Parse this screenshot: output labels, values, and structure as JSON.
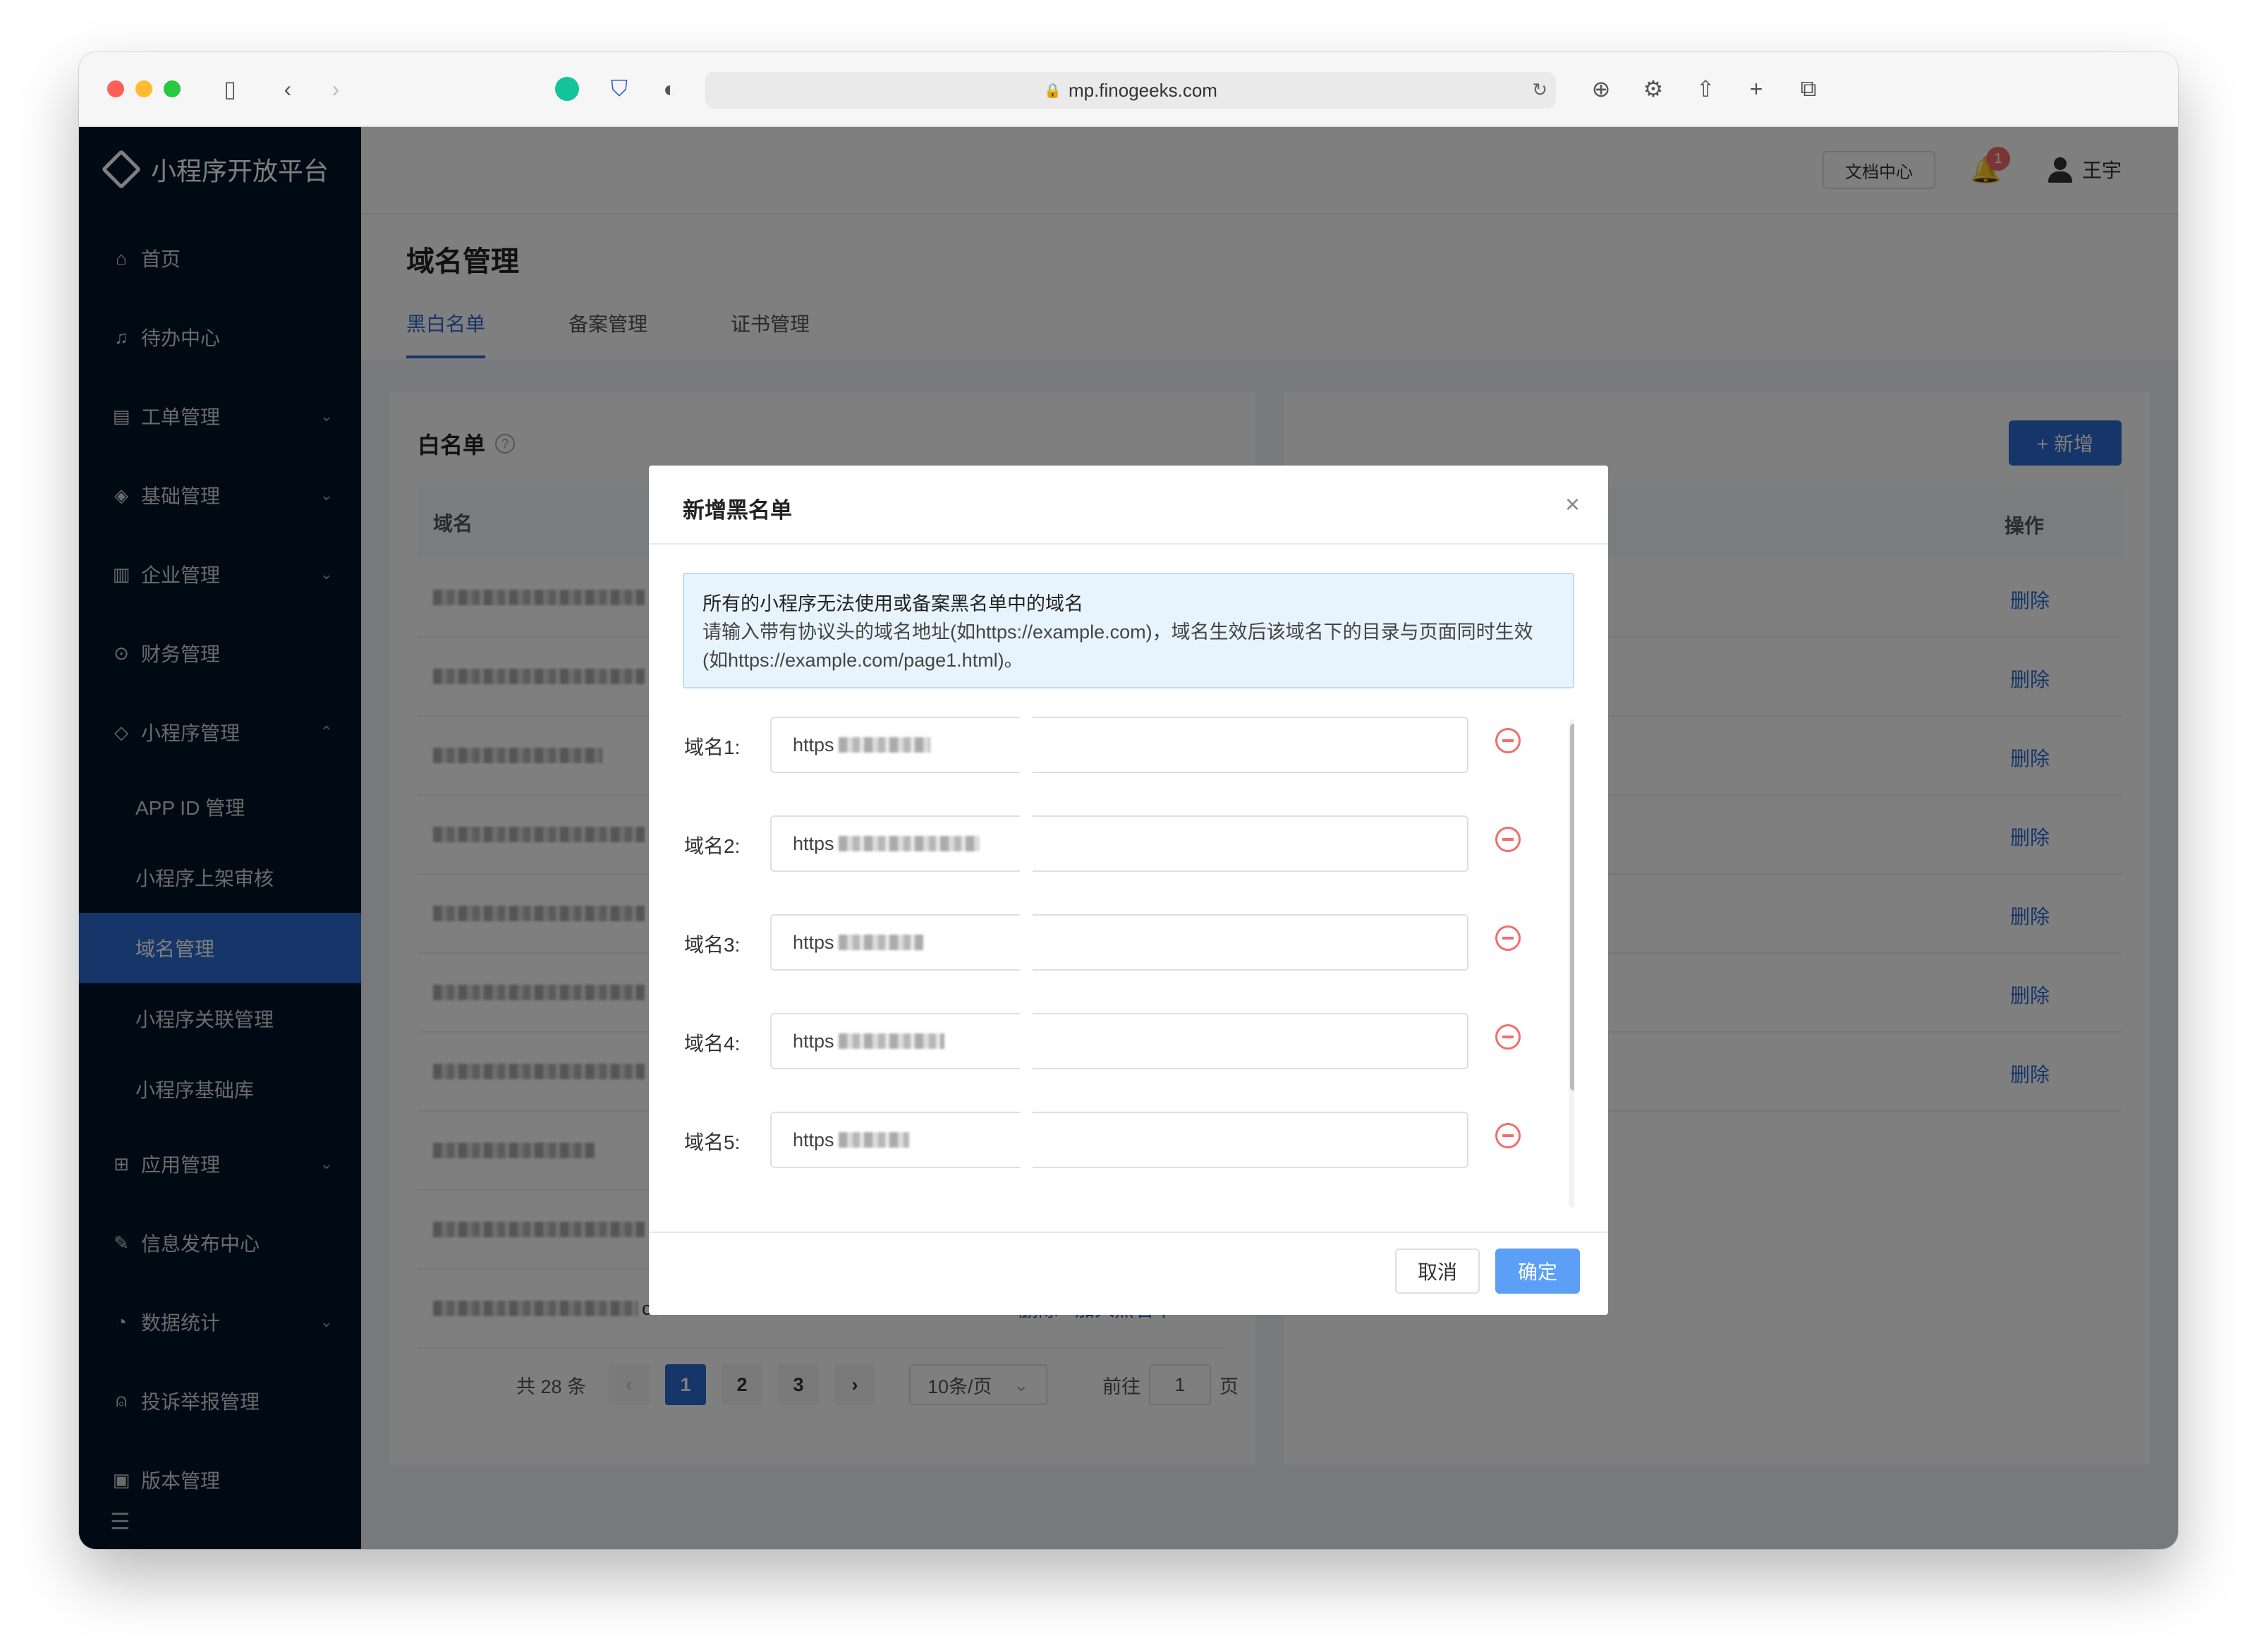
{
  "browser": {
    "url": "mp.finogeeks.com"
  },
  "header": {
    "doc_center": "文档中心",
    "notification_count": "1",
    "user_name": "王宇"
  },
  "sidebar": {
    "logo_text": "小程序开放平台",
    "items": [
      {
        "label": "首页",
        "icon": "home-icon"
      },
      {
        "label": "待办中心",
        "icon": "bell-icon"
      },
      {
        "label": "工单管理",
        "icon": "document-icon"
      },
      {
        "label": "基础管理",
        "icon": "layers-icon"
      },
      {
        "label": "企业管理",
        "icon": "building-icon"
      },
      {
        "label": "财务管理",
        "icon": "finance-icon"
      },
      {
        "label": "小程序管理",
        "icon": "miniprogram-icon"
      }
    ],
    "subitems": [
      {
        "label": "APP ID 管理"
      },
      {
        "label": "小程序上架审核"
      },
      {
        "label": "域名管理"
      },
      {
        "label": "小程序关联管理"
      },
      {
        "label": "小程序基础库"
      }
    ],
    "items_after": [
      {
        "label": "应用管理",
        "icon": "grid-icon"
      },
      {
        "label": "信息发布中心",
        "icon": "edit-icon"
      },
      {
        "label": "数据统计",
        "icon": "chart-icon"
      },
      {
        "label": "投诉举报管理",
        "icon": "alarm-icon"
      },
      {
        "label": "版本管理",
        "icon": "version-icon"
      }
    ]
  },
  "page": {
    "title": "域名管理",
    "tabs": [
      "黑白名单",
      "备案管理",
      "证书管理"
    ]
  },
  "whitelist": {
    "title": "白名单",
    "col_domain": "域名",
    "last_row_suffix": "com",
    "delete_label": "删除",
    "add_blacklist_label": "加入黑名单",
    "pagination": {
      "total": "共 28 条",
      "pages": [
        "1",
        "2",
        "3"
      ],
      "page_size": "10条/页",
      "goto_prefix": "前往",
      "goto_value": "1",
      "goto_suffix": "页"
    }
  },
  "blacklist": {
    "add_button": "+ 新增",
    "col_action": "操作",
    "delete_label": "删除"
  },
  "modal": {
    "title": "新增黑名单",
    "notice_line1": "所有的小程序无法使用或备案黑名单中的域名",
    "notice_line2": "请输入带有协议头的域名地址(如https://example.com)，域名生效后该域名下的目录与页面同时生效(如https://example.com/page1.html)。",
    "fields": [
      {
        "label": "域名1:",
        "value": "https"
      },
      {
        "label": "域名2:",
        "value": "https"
      },
      {
        "label": "域名3:",
        "value": "https"
      },
      {
        "label": "域名4:",
        "value": "https"
      },
      {
        "label": "域名5:",
        "value": "https"
      }
    ],
    "cancel": "取消",
    "confirm": "确定"
  }
}
